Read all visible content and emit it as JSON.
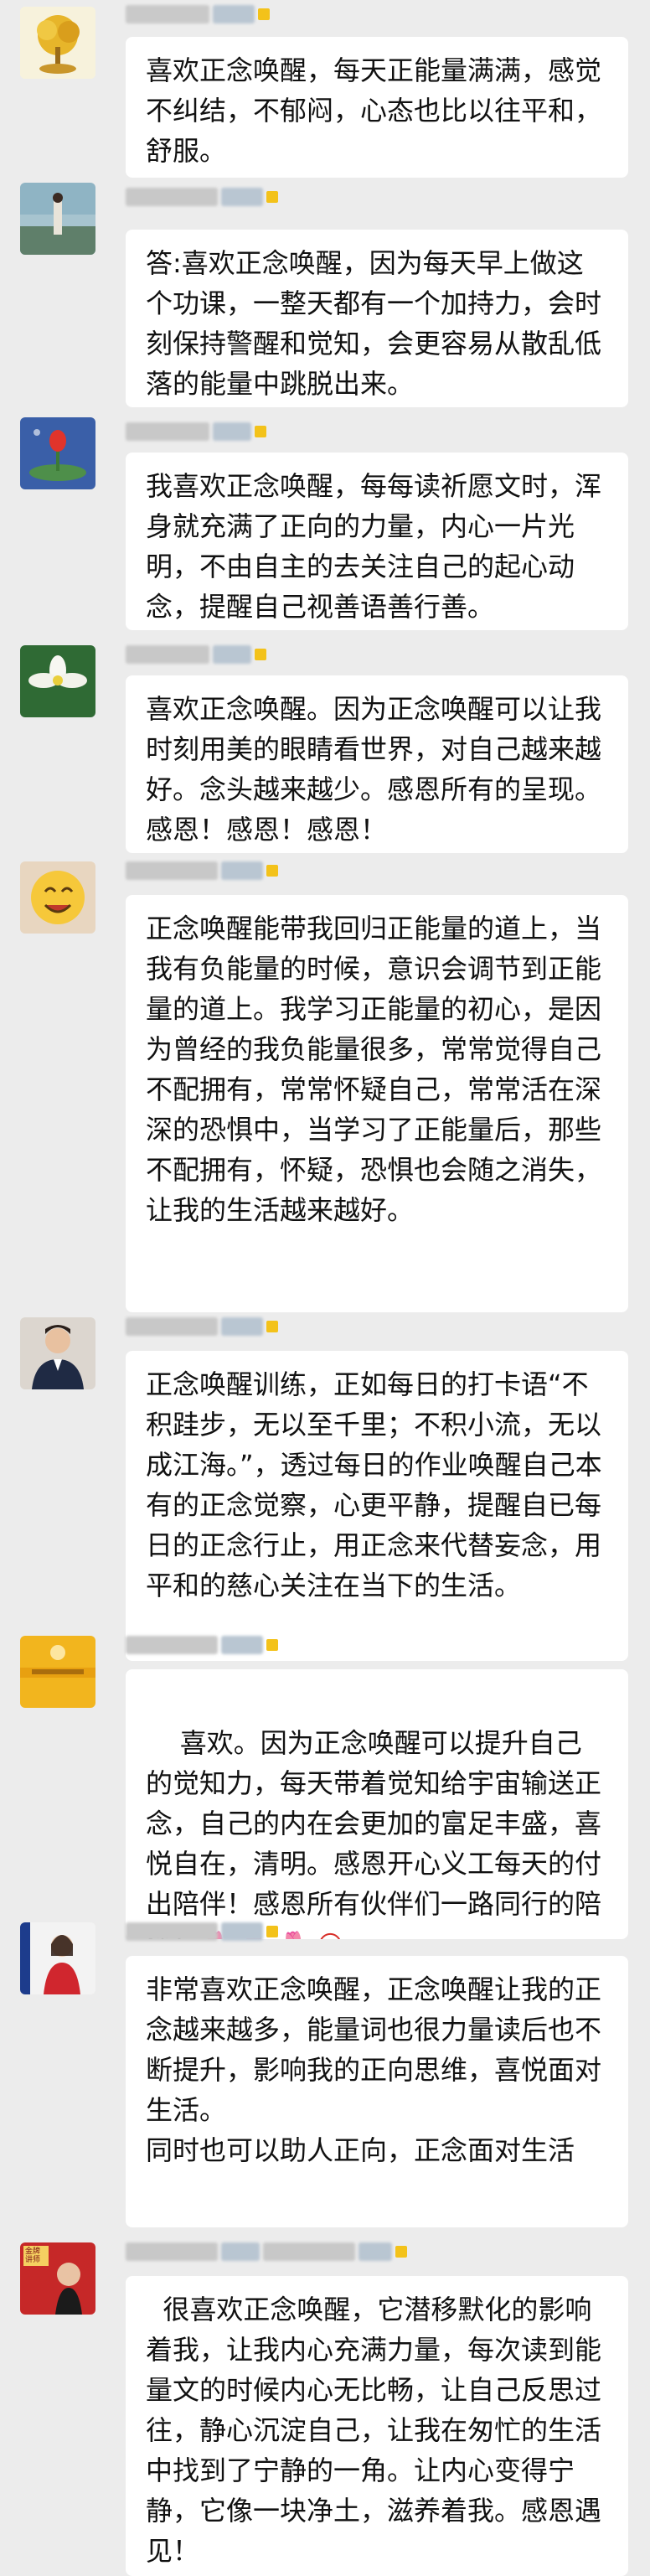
{
  "messages": [
    {
      "avatar": "gold-tree-avatar",
      "text": "喜欢正念唤醒，每天正能量满满，感觉不纠结，不郁闷，心态也比以往平和，舒服。"
    },
    {
      "avatar": "lakeside-woman-avatar",
      "text": "答:喜欢正念唤醒，因为每天早上做这个功课，一整天都有一个加持力，会时刻保持警醒和觉知，会更容易从散乱低落的能量中跳脱出来。"
    },
    {
      "avatar": "tulip-lotus-avatar",
      "text": "我喜欢正念唤醒，每每读祈愿文时，浑身就充满了正向的力量，内心一片光明，不由自主的去关注自己的起心动念，提醒自己视善语善行善。"
    },
    {
      "avatar": "white-flower-avatar",
      "text": "喜欢正念唤醒。因为正念唤醒可以让我时刻用美的眼睛看世界，对自己越来越好。念头越来越少。感恩所有的呈现。感恩！感恩！感恩！"
    },
    {
      "avatar": "smiley-avatar",
      "text": "正念唤醒能带我回归正能量的道上，当我有负能量的时候，意识会调节到正能量的道上。我学习正能量的初心，是因为曾经的我负能量很多，常常觉得自己不配拥有，常常怀疑自己，常常活在深深的恐惧中，当学习了正能量后，那些不配拥有，怀疑，恐惧也会随之消失，让我的生活越来越好。"
    },
    {
      "avatar": "man-in-suit-avatar",
      "text": "正念唤醒训练，正如每日的打卡语“不积跬步，无以至千里；不积小流，无以成江海。”，透过每日的作业唤醒自己本有的正念觉察，心更平静，提醒自已每日的正念行止，用正念来代替妄念，用平和的慈心关注在当下的生活。"
    },
    {
      "avatar": "golden-poster-avatar",
      "text": "喜欢。因为正念唤醒可以提升自己的觉知力，每天带着觉知给宇宙输送正念，自己的内在会更加的富足丰盛，喜悦自在，清明。感恩开心义工每天的付出陪伴！感恩所有伙伴们一路同行的陪伴！",
      "emoji": "🌷 🌷 🌷 😀"
    },
    {
      "avatar": "woman-red-dress-avatar",
      "text": "非常喜欢正念唤醒，正念唤醒让我的正念越来越多，能量词也很力量读后也不断提升，影响我的正向思维，喜悦面对生活。\n同时也可以助人正向，正念面对生活"
    },
    {
      "avatar": "red-banner-avatar",
      "avatar_text": "金牌\n讲师",
      "text": "  很喜欢正念唤醒，它潜移默化的影响着我，让我内心充满力量，每次读到能量文的时候内心无比畅，让自己反思过往，静心沉淀自己，让我在匆忙的生活中找到了宁静的一角。让内心变得宁静，它像一块净土，滋养着我。感恩遇见！"
    }
  ],
  "colors": {
    "background": "#ececec",
    "bubble": "#ffffff",
    "badge": "#f3c21a"
  }
}
